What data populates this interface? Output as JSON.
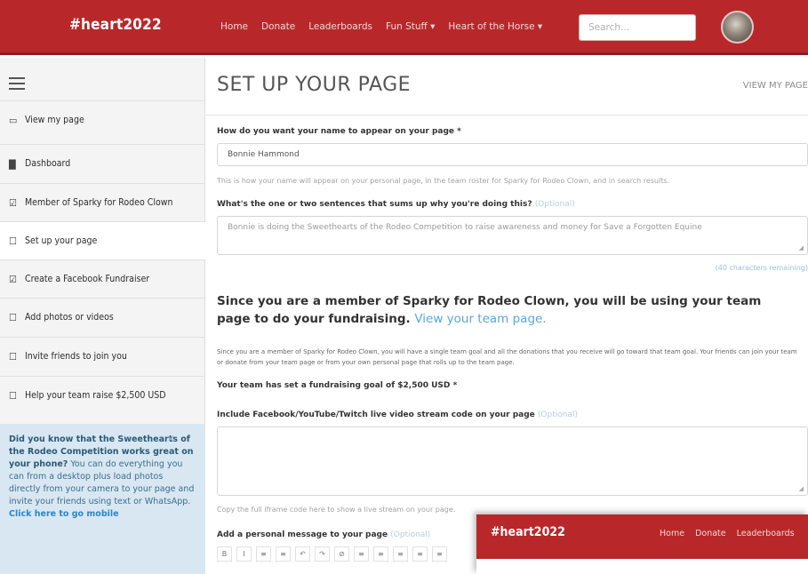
{
  "header": {
    "brand": "#heart2022",
    "nav": [
      "Home",
      "Donate",
      "Leaderboards",
      "Fun Stuff ▾",
      "Heart of the Horse ▾"
    ],
    "search_placeholder": "Search..."
  },
  "sidebar": {
    "items": [
      {
        "icon": "▭",
        "label": "View my page"
      },
      {
        "icon": "▇",
        "label": "Dashboard"
      },
      {
        "icon": "☑",
        "label": "Member of Sparky for Rodeo Clown"
      },
      {
        "icon": "☐",
        "label": "Set up your page"
      },
      {
        "icon": "☑",
        "label": "Create a Facebook Fundraiser"
      },
      {
        "icon": "☐",
        "label": "Add photos or videos"
      },
      {
        "icon": "☐",
        "label": "Invite friends to join you"
      },
      {
        "icon": "☐",
        "label": "Help your team raise $2,500 USD"
      }
    ],
    "tip": {
      "bold": "Did you know that the Sweethearts of the Rodeo Competition works great on your phone?",
      "text": " You can do everything you can from a desktop plus load photos directly from your camera to your page and invite your friends using text or WhatsApp. ",
      "link": "Click here to go mobile",
      "close": "×"
    }
  },
  "main": {
    "title": "SET UP YOUR PAGE",
    "view_link": "VIEW MY PAGE",
    "name_label": "How do you want your name to appear on your page *",
    "name_value": "Bonnie Hammond",
    "name_help": "This is how your name will appear on your personal page, in the team roster for Sparky for Rodeo Clown, and in search results.",
    "summary_label": "What's the one or two sentences that sums up why you're doing this?",
    "optional": "(Optional)",
    "summary_value": "Bonnie is doing the Sweethearts of the Rodeo Competition to raise awareness and money for Save a Forgotten Equine",
    "summary_counter": "(40 characters remaining)",
    "team_heading": "Since you are a member of Sparky for Rodeo Clown, you will be using your team page to do your fundraising.",
    "team_link": "View your team page.",
    "team_para": "Since you are a member of Sparky for Rodeo Clown, you will have a single team goal and all the donations that you receive will go toward that team goal. Your friends can join your team or donate from your team page or from your own personal page that rolls up to the team page.",
    "goal_label": "Your team has set a fundraising goal of $2,500 USD *",
    "video_label": "Include Facebook/YouTube/Twitch live video stream code on your page",
    "video_help": "Copy the full iframe code here to show a live stream on your page.",
    "message_label": "Add a personal message to your page",
    "toolbar": [
      "B",
      "I",
      "≡",
      "≡",
      "↶",
      "↷",
      "⊘",
      "≡",
      "≡",
      "≡",
      "≡",
      "≡"
    ]
  },
  "overlay": {
    "brand": "#heart2022",
    "nav": [
      "Home",
      "Donate",
      "Leaderboards"
    ]
  }
}
